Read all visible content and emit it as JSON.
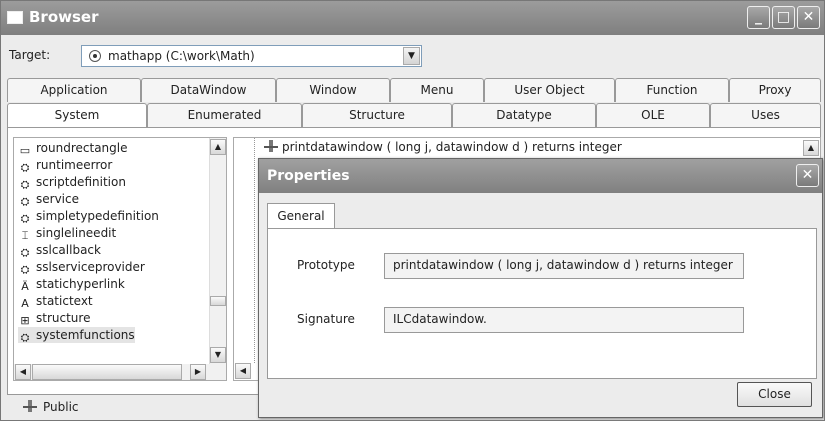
{
  "window": {
    "title": "Browser"
  },
  "target": {
    "label": "Target:",
    "value": "mathapp (C:\\work\\Math)"
  },
  "tabs_row1": [
    "Application",
    "DataWindow",
    "Window",
    "Menu",
    "User Object",
    "Function",
    "Proxy"
  ],
  "tabs_row2": [
    "System",
    "Enumerated",
    "Structure",
    "Datatype",
    "OLE",
    "Uses"
  ],
  "list_items": [
    {
      "label": "roundrectangle",
      "icon": "round-rectangle-icon"
    },
    {
      "label": "runtimeerror",
      "icon": "class-icon"
    },
    {
      "label": "scriptdefinition",
      "icon": "class-icon"
    },
    {
      "label": "service",
      "icon": "class-icon"
    },
    {
      "label": "simpletypedefinition",
      "icon": "class-icon"
    },
    {
      "label": "singlelineedit",
      "icon": "singlelineedit-icon"
    },
    {
      "label": "sslcallback",
      "icon": "class-icon"
    },
    {
      "label": "sslserviceprovider",
      "icon": "class-icon"
    },
    {
      "label": "statichyperlink",
      "icon": "statichyperlink-icon"
    },
    {
      "label": "statictext",
      "icon": "statictext-icon"
    },
    {
      "label": "structure",
      "icon": "structure-icon"
    },
    {
      "label": "systemfunctions",
      "icon": "class-icon"
    }
  ],
  "tree": {
    "item": "printdatawindow ( long j, datawindow d )  returns integer"
  },
  "status": {
    "text": "Public"
  },
  "dialog": {
    "title": "Properties",
    "tab": "General",
    "prototype_label": "Prototype",
    "prototype_value": "printdatawindow ( long j, datawindow d )  returns integer",
    "signature_label": "Signature",
    "signature_value": "ILCdatawindow.",
    "close_label": "Close"
  }
}
